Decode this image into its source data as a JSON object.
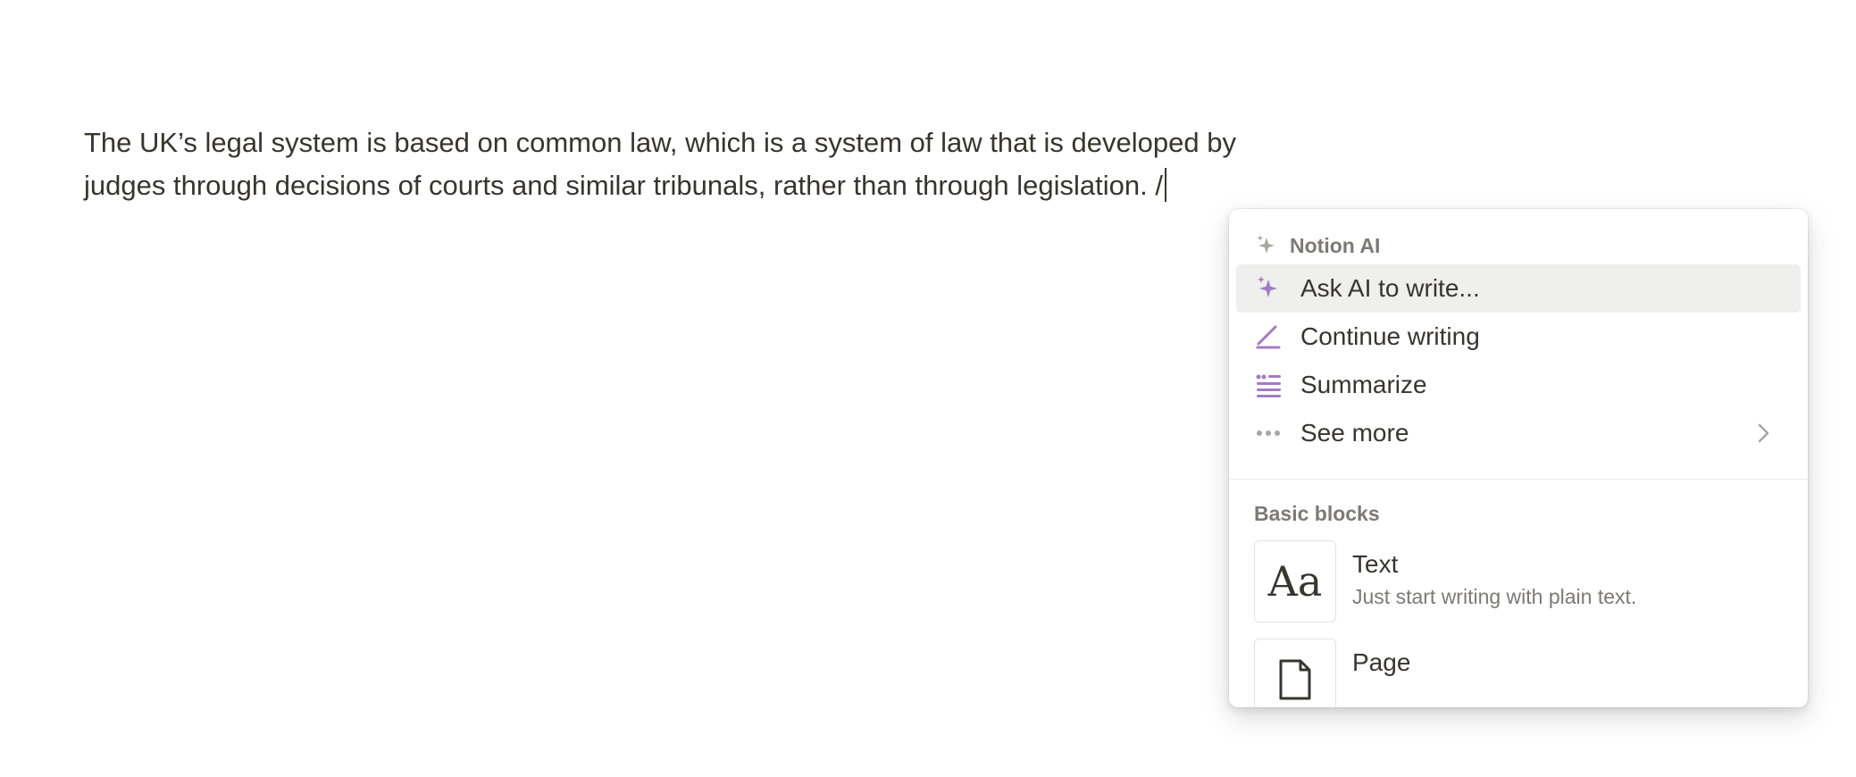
{
  "editor": {
    "line1": "The UK’s legal system is based on common law, which is a system of law that is developed by",
    "line2": "judges through decisions of courts and similar tribunals, rather than through legislation. /"
  },
  "menu": {
    "ai_section_label": "Notion AI",
    "ai_items": [
      {
        "label": "Ask AI to write...",
        "icon": "sparkle-icon"
      },
      {
        "label": "Continue writing",
        "icon": "pen-icon"
      },
      {
        "label": "Summarize",
        "icon": "summarize-icon"
      },
      {
        "label": "See more",
        "icon": "more-icon"
      }
    ],
    "basic_section_label": "Basic blocks",
    "blocks": [
      {
        "title": "Text",
        "description": "Just start writing with plain text.",
        "icon": "Aa"
      },
      {
        "title": "Page",
        "icon": "page-icon"
      }
    ]
  },
  "colors": {
    "ai_accent": "#a27cc4",
    "text": "#37352f",
    "muted": "#7d7a75",
    "selected_bg": "#efefed"
  }
}
